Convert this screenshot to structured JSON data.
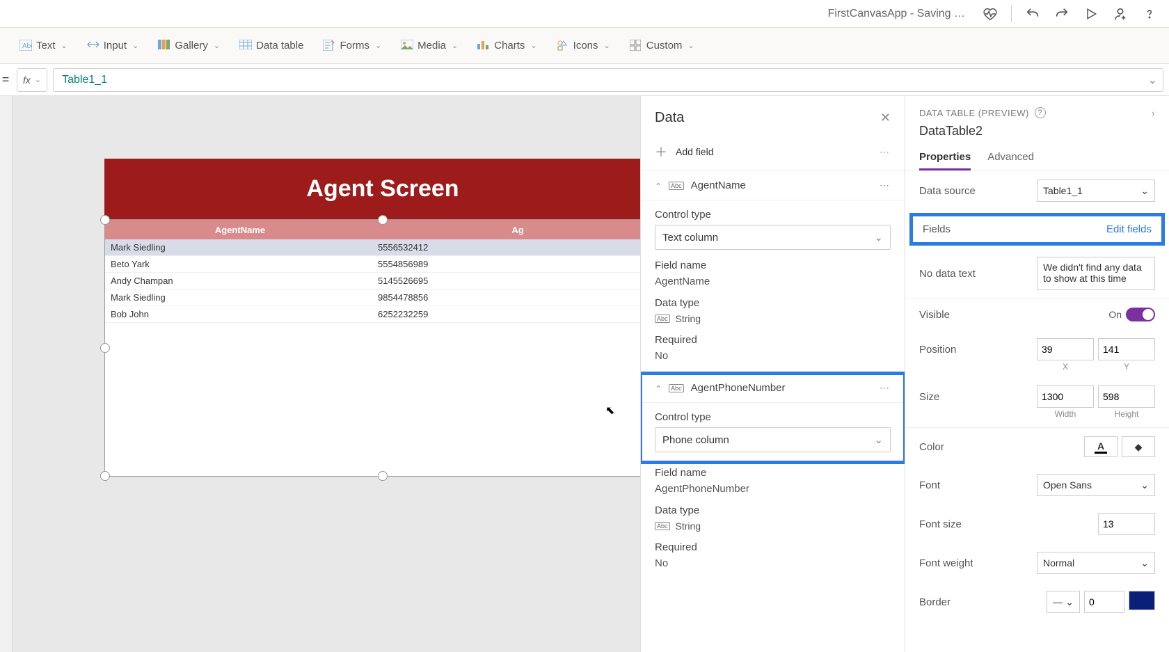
{
  "titlebar": {
    "title": "FirstCanvasApp - Saving …"
  },
  "ribbon": {
    "text": "Text",
    "input": "Input",
    "gallery": "Gallery",
    "datatable": "Data table",
    "forms": "Forms",
    "media": "Media",
    "charts": "Charts",
    "icons": "Icons",
    "custom": "Custom"
  },
  "formula": {
    "value": "Table1_1"
  },
  "canvas": {
    "screen_title": "Agent Screen",
    "columns": [
      "AgentName",
      "Ag"
    ],
    "rows": [
      {
        "name": "Mark Siedling",
        "phone": "5556532412",
        "selected": true
      },
      {
        "name": "Beto Yark",
        "phone": "5554856989"
      },
      {
        "name": "Andy Champan",
        "phone": "5145526695"
      },
      {
        "name": "Mark Siedling",
        "phone": "9854478856"
      },
      {
        "name": "Bob John",
        "phone": "6252232259"
      }
    ]
  },
  "datapanel": {
    "title": "Data",
    "add_field": "Add field",
    "fields": [
      {
        "name": "AgentName",
        "control_type_label": "Control type",
        "control_type": "Text column",
        "field_name_label": "Field name",
        "field_name": "AgentName",
        "data_type_label": "Data type",
        "data_type": "String",
        "required_label": "Required",
        "required": "No"
      },
      {
        "name": "AgentPhoneNumber",
        "control_type_label": "Control type",
        "control_type": "Phone column",
        "field_name_label": "Field name",
        "field_name": "AgentPhoneNumber",
        "data_type_label": "Data type",
        "data_type": "String",
        "required_label": "Required",
        "required": "No"
      }
    ]
  },
  "props": {
    "header": "DATA TABLE (PREVIEW)",
    "name": "DataTable2",
    "tabs": {
      "properties": "Properties",
      "advanced": "Advanced"
    },
    "data_source_label": "Data source",
    "data_source": "Table1_1",
    "fields_label": "Fields",
    "edit_fields": "Edit fields",
    "no_data_label": "No data text",
    "no_data_value": "We didn't find any data to show at this time",
    "visible_label": "Visible",
    "visible_value": "On",
    "position_label": "Position",
    "position_x": "39",
    "position_y": "141",
    "pos_x_sub": "X",
    "pos_y_sub": "Y",
    "size_label": "Size",
    "size_w": "1300",
    "size_h": "598",
    "size_w_sub": "Width",
    "size_h_sub": "Height",
    "color_label": "Color",
    "font_label": "Font",
    "font_value": "Open Sans",
    "fontsize_label": "Font size",
    "fontsize_value": "13",
    "fontweight_label": "Font weight",
    "fontweight_value": "Normal",
    "border_label": "Border",
    "border_width": "0"
  }
}
